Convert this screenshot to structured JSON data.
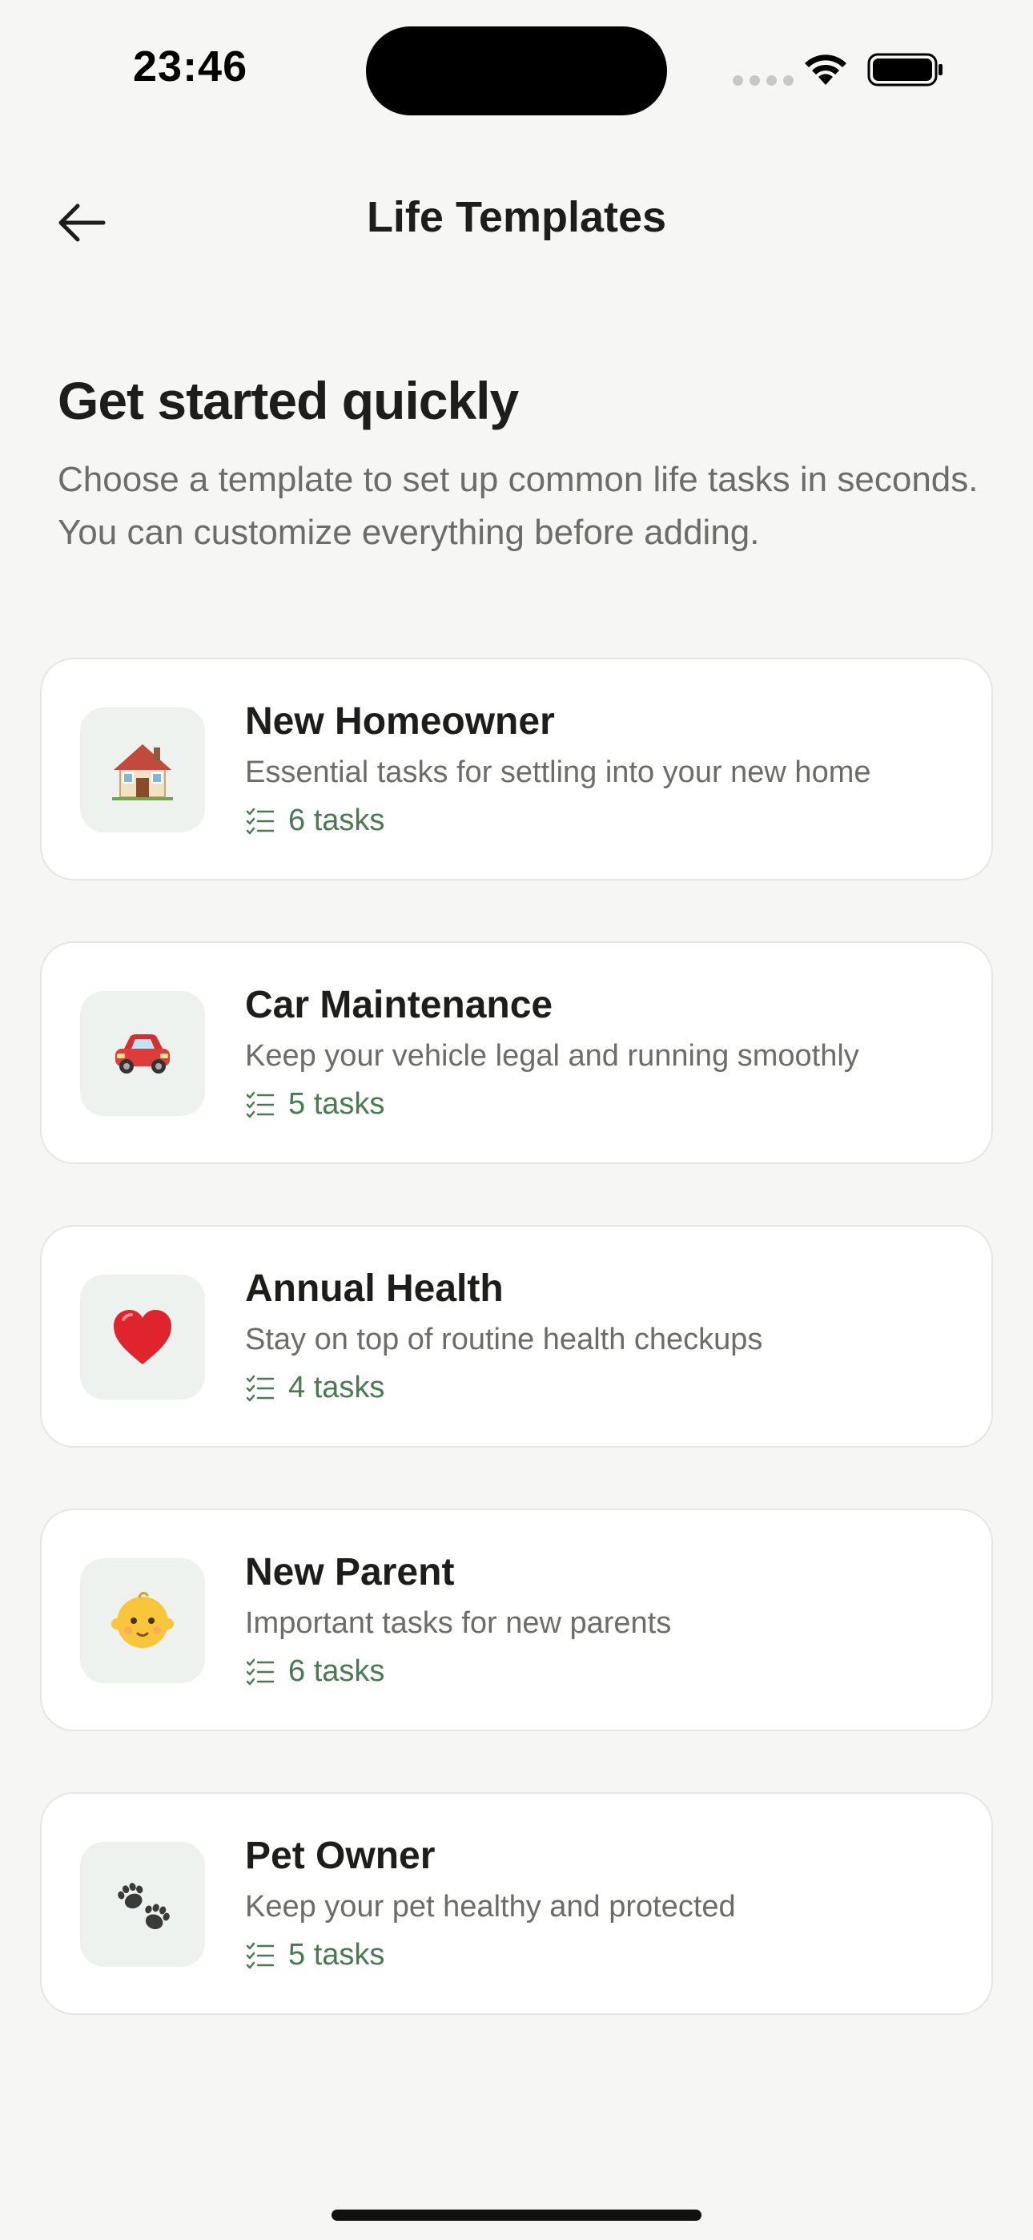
{
  "status_bar": {
    "time": "23:46"
  },
  "header": {
    "title": "Life Templates"
  },
  "intro": {
    "heading": "Get started quickly",
    "description": "Choose a template to set up common life tasks in seconds. You can customize everything before adding."
  },
  "templates": [
    {
      "icon": "house-icon",
      "title": "New Homeowner",
      "description": "Essential tasks for settling into your new home",
      "count": "6 tasks"
    },
    {
      "icon": "car-icon",
      "title": "Car Maintenance",
      "description": "Keep your vehicle legal and running smoothly",
      "count": "5 tasks"
    },
    {
      "icon": "heart-icon",
      "title": "Annual Health",
      "description": "Stay on top of routine health checkups",
      "count": "4 tasks"
    },
    {
      "icon": "baby-icon",
      "title": "New Parent",
      "description": "Important tasks for new parents",
      "count": "6 tasks"
    },
    {
      "icon": "paw-icon",
      "title": "Pet Owner",
      "description": "Keep your pet healthy and protected",
      "count": "5 tasks"
    }
  ],
  "colors": {
    "background": "#f6f6f4",
    "accent_green": "#4a7a4f",
    "icon_box": "#eef2ee"
  }
}
